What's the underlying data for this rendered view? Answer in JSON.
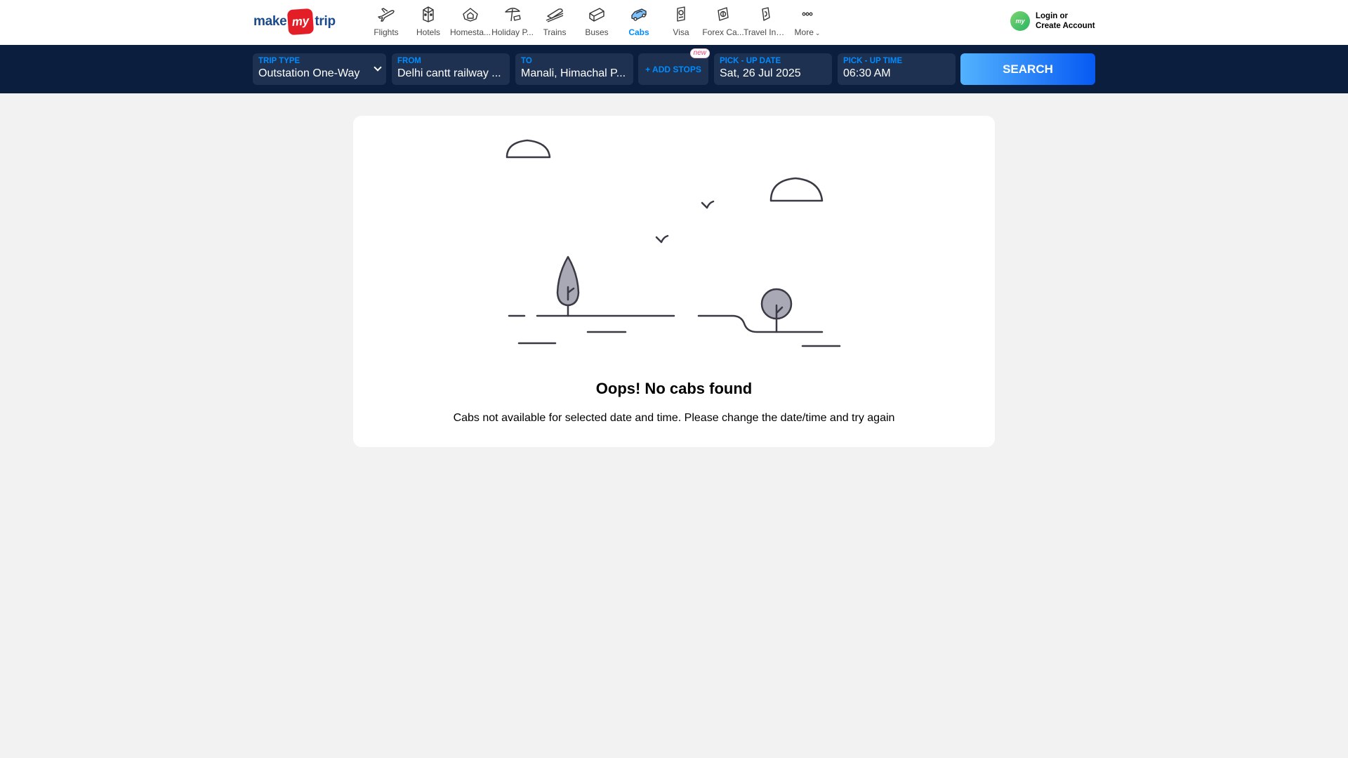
{
  "header": {
    "logo": {
      "part1": "make",
      "part2": "my",
      "part3": "trip"
    },
    "nav": [
      {
        "label": "Flights",
        "icon": "flight-icon",
        "active": false
      },
      {
        "label": "Hotels",
        "icon": "hotel-icon",
        "active": false
      },
      {
        "label": "Homesta...",
        "icon": "homestay-icon",
        "active": false
      },
      {
        "label": "Holiday P...",
        "icon": "holiday-icon",
        "active": false
      },
      {
        "label": "Trains",
        "icon": "train-icon",
        "active": false
      },
      {
        "label": "Buses",
        "icon": "bus-icon",
        "active": false
      },
      {
        "label": "Cabs",
        "icon": "cab-icon",
        "active": true
      },
      {
        "label": "Visa",
        "icon": "visa-icon",
        "active": false
      },
      {
        "label": "Forex Ca...",
        "icon": "forex-icon",
        "active": false
      },
      {
        "label": "Travel Ins...",
        "icon": "insurance-icon",
        "active": false
      },
      {
        "label": "More",
        "icon": "more-icon",
        "active": false
      }
    ],
    "login": {
      "avatar_text": "my",
      "line1": "Login or",
      "line2": "Create Account"
    }
  },
  "search": {
    "trip_type": {
      "label": "TRIP TYPE",
      "value": "Outstation One-Way"
    },
    "from": {
      "label": "FROM",
      "value": "Delhi cantt railway ..."
    },
    "to": {
      "label": "TO",
      "value": "Manali, Himachal P..."
    },
    "add_stops": {
      "label": "+ ADD STOPS",
      "badge": "new"
    },
    "pickup_date": {
      "label": "PICK - UP DATE",
      "value": "Sat, 26 Jul 2025"
    },
    "pickup_time": {
      "label": "PICK - UP TIME",
      "value": "06:30 AM"
    },
    "search_button": "SEARCH"
  },
  "empty_state": {
    "title": "Oops! No cabs found",
    "message": "Cabs not available for selected date and time. Please change the date/time and try again",
    "illustration": "no-results-landscape-illustration"
  },
  "colors": {
    "brand_red": "#e41e26",
    "brand_blue": "#1a4a8c",
    "accent_blue": "#008cff",
    "search_bar_bg": "#0b1e3d",
    "field_bg": "#1e3150",
    "page_bg": "#f2f2f2"
  }
}
